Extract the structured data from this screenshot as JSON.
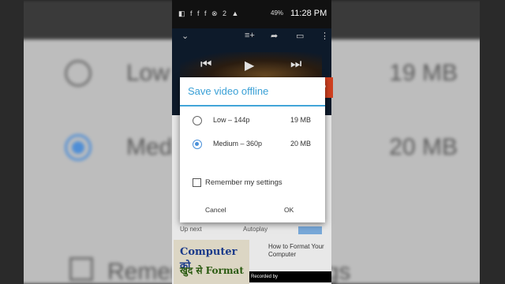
{
  "status_bar": {
    "notification_icons": "◧ f f f ⊗ 2 ▲",
    "battery": "49%",
    "time": "11:28 PM"
  },
  "player": {
    "icons": [
      "chevron-down-icon",
      "add-to-playlist-icon",
      "share-icon",
      "cast-icon",
      "more-icon",
      "previous-icon",
      "play-icon",
      "next-icon"
    ]
  },
  "dialog": {
    "title": "Save video offline",
    "options": [
      {
        "label": "Low – 144p",
        "size": "19 MB",
        "selected": false
      },
      {
        "label": "Medium – 360p",
        "size": "20 MB",
        "selected": true
      }
    ],
    "remember_label": "Remember my settings",
    "remember_checked": false,
    "cancel_label": "Cancel",
    "ok_label": "OK"
  },
  "below": {
    "up_next": "Up next",
    "autoplay": "Autoplay",
    "thumb_line1": "Computer को",
    "thumb_line2": "खुद से Format",
    "video_title": "How to Format Your Computer",
    "recorded": "Recorded by"
  },
  "background": {
    "low_label": "Low",
    "low_size": "19 MB",
    "medium_label": "Med",
    "medium_size": "20 MB",
    "remember_label": "Remember my settings"
  },
  "colors": {
    "accent": "#42a5d8",
    "radio_selected": "#4a90d9"
  }
}
